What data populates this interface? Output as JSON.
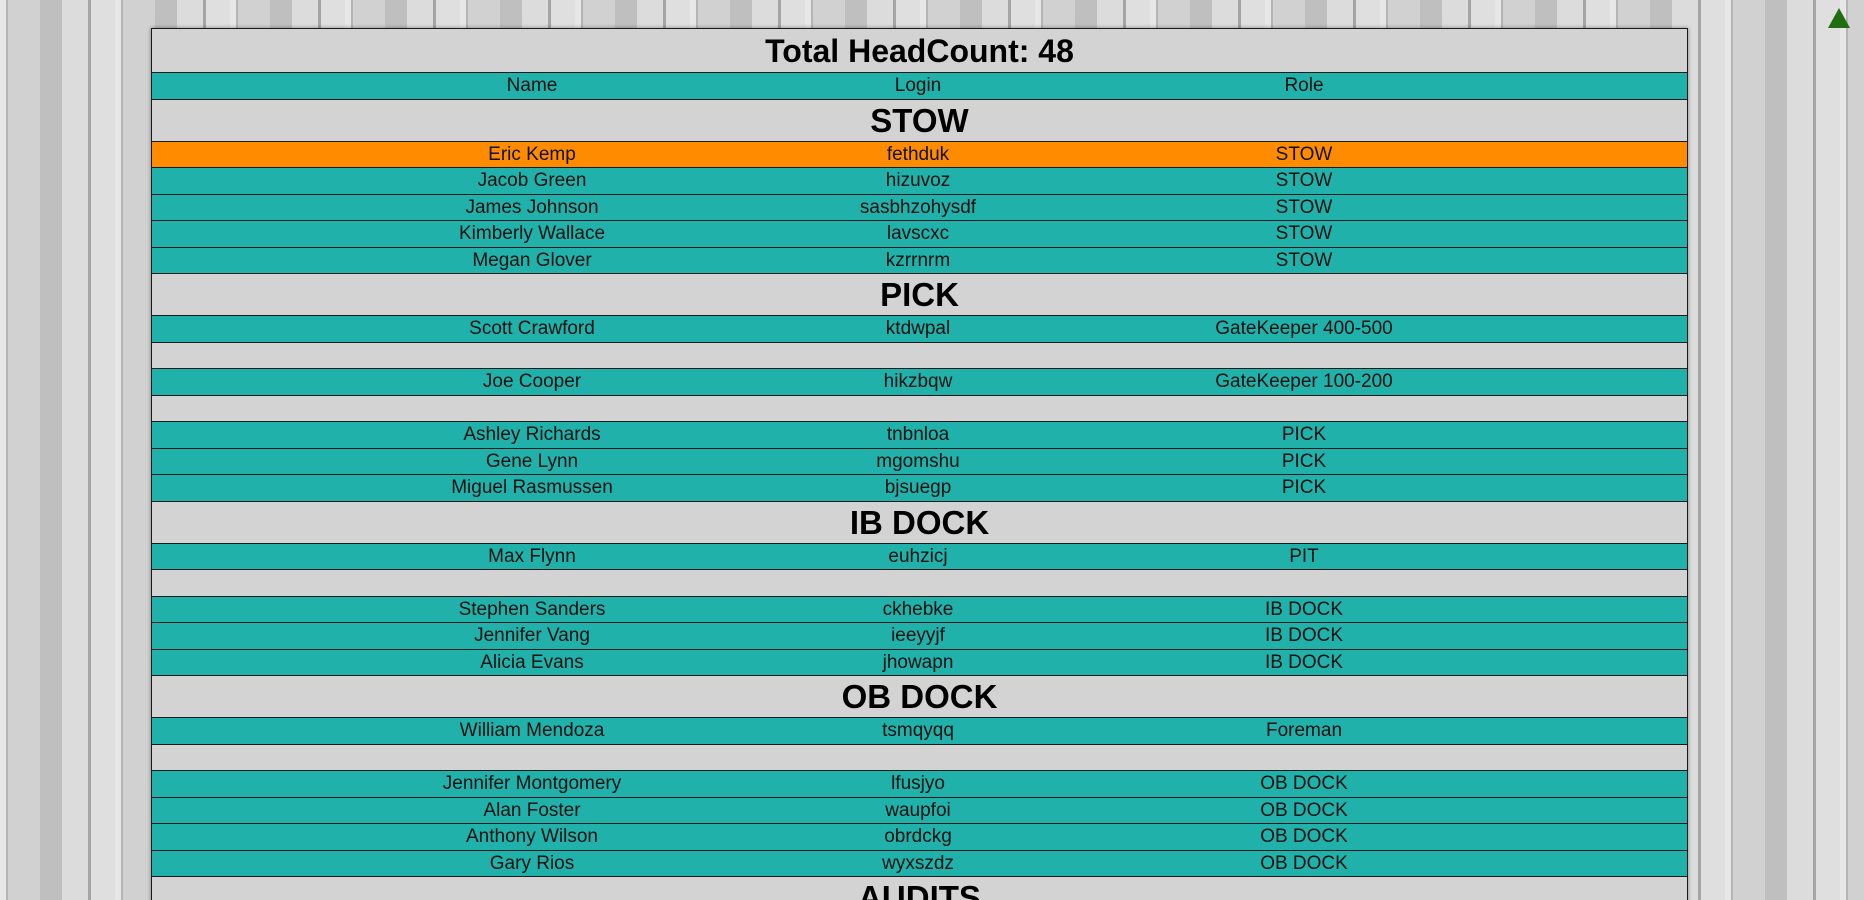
{
  "title": "Total HeadCount: 48",
  "columns": {
    "name": "Name",
    "login": "Login",
    "role": "Role"
  },
  "sections": [
    {
      "title": "STOW",
      "rows": [
        {
          "name": "Eric Kemp",
          "login": "fethduk",
          "role": "STOW",
          "highlight": true
        },
        {
          "name": "Jacob Green",
          "login": "hizuvoz",
          "role": "STOW"
        },
        {
          "name": "James Johnson",
          "login": "sasbhzohysdf",
          "role": "STOW"
        },
        {
          "name": "Kimberly Wallace",
          "login": "lavscxc",
          "role": "STOW"
        },
        {
          "name": "Megan Glover",
          "login": "kzrrnrm",
          "role": "STOW"
        }
      ]
    },
    {
      "title": "PICK",
      "rows": [
        {
          "name": "Scott Crawford",
          "login": "ktdwpal",
          "role": "GateKeeper 400-500"
        },
        {
          "spacer": true
        },
        {
          "name": "Joe Cooper",
          "login": "hikzbqw",
          "role": "GateKeeper 100-200"
        },
        {
          "spacer": true
        },
        {
          "name": "Ashley Richards",
          "login": "tnbnloa",
          "role": "PICK"
        },
        {
          "name": "Gene Lynn",
          "login": "mgomshu",
          "role": "PICK"
        },
        {
          "name": "Miguel Rasmussen",
          "login": "bjsuegp",
          "role": "PICK"
        }
      ]
    },
    {
      "title": "IB DOCK",
      "rows": [
        {
          "name": "Max Flynn",
          "login": "euhzicj",
          "role": "PIT"
        },
        {
          "spacer": true
        },
        {
          "name": "Stephen Sanders",
          "login": "ckhebke",
          "role": "IB DOCK"
        },
        {
          "name": "Jennifer Vang",
          "login": "ieeyyjf",
          "role": "IB DOCK"
        },
        {
          "name": "Alicia Evans",
          "login": "jhowapn",
          "role": "IB DOCK"
        }
      ]
    },
    {
      "title": "OB DOCK",
      "rows": [
        {
          "name": "William Mendoza",
          "login": "tsmqyqq",
          "role": "Foreman"
        },
        {
          "spacer": true
        },
        {
          "name": "Jennifer Montgomery",
          "login": "lfusjyo",
          "role": "OB DOCK"
        },
        {
          "name": "Alan Foster",
          "login": "waupfoi",
          "role": "OB DOCK"
        },
        {
          "name": "Anthony Wilson",
          "login": "obrdckg",
          "role": "OB DOCK"
        },
        {
          "name": "Gary Rios",
          "login": "wyxszdz",
          "role": "OB DOCK"
        }
      ]
    },
    {
      "title": "AUDITS",
      "rows": []
    }
  ],
  "colors": {
    "row": "#20b2aa",
    "highlight": "#ff8c00",
    "section": "#d3d3d3",
    "scroll_top": "#1f6e12"
  },
  "icons": {
    "scroll_top": "triangle-up-icon"
  }
}
